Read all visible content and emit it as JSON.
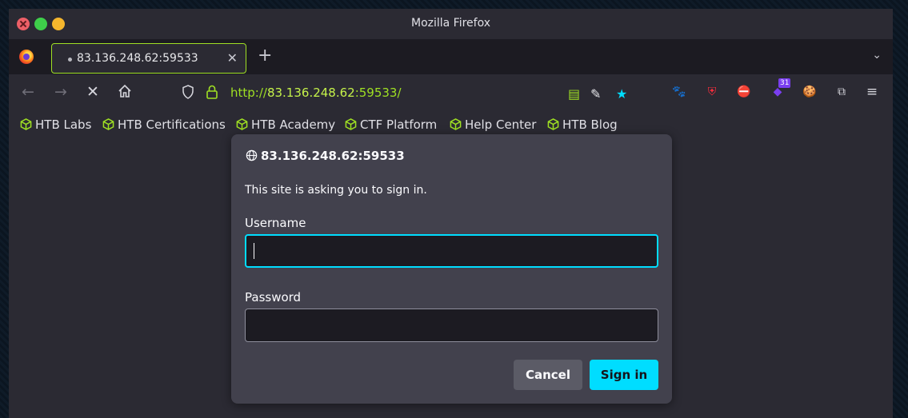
{
  "window": {
    "title": "Mozilla Firefox"
  },
  "tab": {
    "label": "83.136.248.62:59533"
  },
  "url": {
    "scheme": "http://",
    "host": "83.136.248.62",
    "port_path": ":59533/"
  },
  "bookmarks": [
    {
      "label": "HTB Labs"
    },
    {
      "label": "HTB Certifications"
    },
    {
      "label": "HTB Academy"
    },
    {
      "label": "CTF Platform"
    },
    {
      "label": "Help Center"
    },
    {
      "label": "HTB Blog"
    }
  ],
  "extensions": {
    "badge_count": "31"
  },
  "dialog": {
    "host": "83.136.248.62:59533",
    "message": "This site is asking you to sign in.",
    "username_label": "Username",
    "username_value": "",
    "password_label": "Password",
    "password_value": "",
    "cancel_label": "Cancel",
    "signin_label": "Sign in"
  },
  "colors": {
    "accent": "#00ddff",
    "htb_green": "#9fe023",
    "dialog_bg": "#42414d",
    "toolbar_bg": "#2b2a33"
  }
}
